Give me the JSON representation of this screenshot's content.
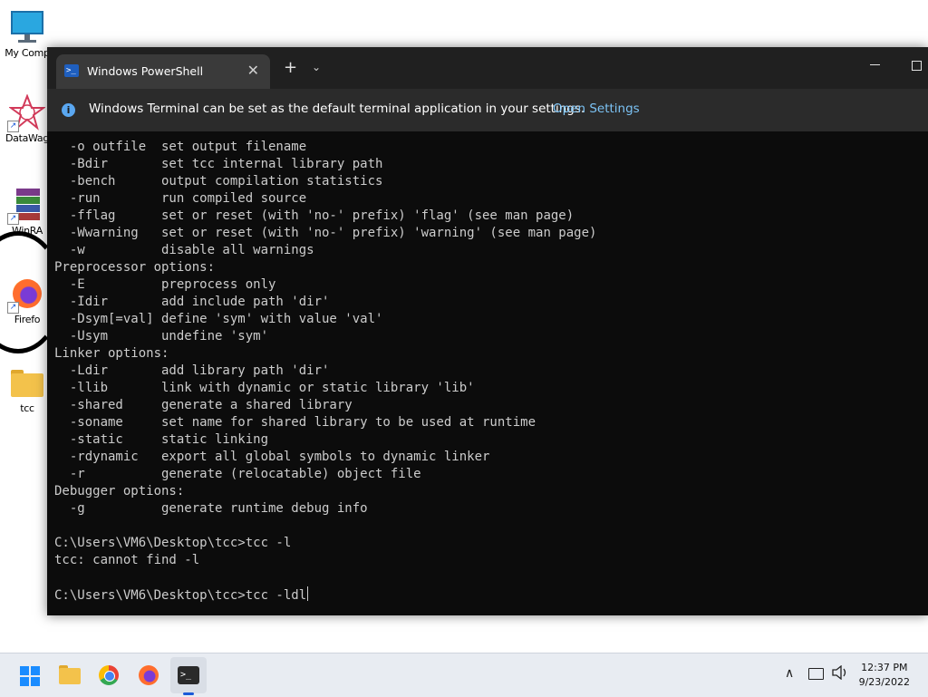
{
  "desktop": {
    "icons": [
      {
        "label": "My Comp",
        "icon": "computer-icon"
      },
      {
        "label": "DataWag",
        "icon": "datawag-icon"
      },
      {
        "label": "WinRA",
        "icon": "winrar-icon"
      },
      {
        "label": "Firefo",
        "icon": "firefox-icon"
      },
      {
        "label": "tcc",
        "icon": "folder-icon"
      }
    ]
  },
  "window": {
    "tab_title": "Windows PowerShell",
    "tab_icon": "powershell-icon",
    "close_glyph": "✕",
    "new_tab_glyph": "+",
    "dropdown_glyph": "⌄",
    "infobar": {
      "message": "Windows Terminal can be set as the default terminal application in your settings.",
      "link": "Open Settings"
    },
    "console_lines": [
      "  -o outfile  set output filename",
      "  -Bdir       set tcc internal library path",
      "  -bench      output compilation statistics",
      "  -run        run compiled source",
      "  -fflag      set or reset (with 'no-' prefix) 'flag' (see man page)",
      "  -Wwarning   set or reset (with 'no-' prefix) 'warning' (see man page)",
      "  -w          disable all warnings",
      "Preprocessor options:",
      "  -E          preprocess only",
      "  -Idir       add include path 'dir'",
      "  -Dsym[=val] define 'sym' with value 'val'",
      "  -Usym       undefine 'sym'",
      "Linker options:",
      "  -Ldir       add library path 'dir'",
      "  -llib       link with dynamic or static library 'lib'",
      "  -shared     generate a shared library",
      "  -soname     set name for shared library to be used at runtime",
      "  -static     static linking",
      "  -rdynamic   export all global symbols to dynamic linker",
      "  -r          generate (relocatable) object file",
      "Debugger options:",
      "  -g          generate runtime debug info",
      "",
      "C:\\Users\\VM6\\Desktop\\tcc>tcc -l",
      "tcc: cannot find -l",
      ""
    ],
    "prompt_line": "C:\\Users\\VM6\\Desktop\\tcc>tcc -ldl"
  },
  "taskbar": {
    "apps": [
      "start-icon",
      "file-explorer-icon",
      "chrome-icon",
      "firefox-icon",
      "terminal-icon"
    ],
    "tray_chevron": "∧",
    "time": "12:37 PM",
    "date": "9/23/2022"
  }
}
